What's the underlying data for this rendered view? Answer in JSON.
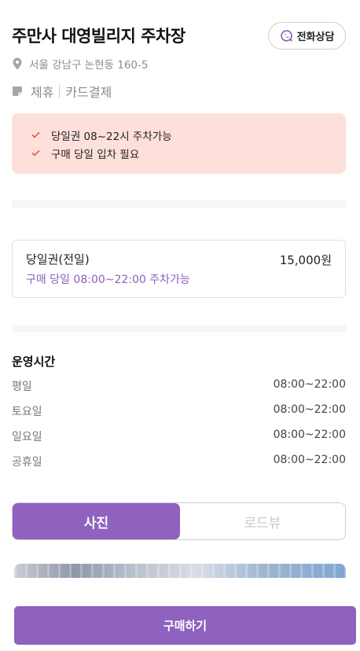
{
  "header": {
    "title": "주만사 대영빌리지 주차장",
    "call_button": {
      "label": "전화상담",
      "icon": "phone-chat-icon"
    }
  },
  "address": {
    "icon": "location-pin-icon",
    "text": "서울 강남구 논현동 160-5"
  },
  "tags": {
    "icon": "tag-icon",
    "items": [
      "제휴",
      "카드결제"
    ]
  },
  "notice": {
    "icon": "check-icon",
    "items": [
      "당일권 08~22시 주차가능",
      "구매 당일 입차 필요"
    ]
  },
  "ticket": {
    "name": "당일권(전일)",
    "price": "15,000원",
    "description": "구매 당일 08:00~22:00 주차가능"
  },
  "hours": {
    "title": "운영시간",
    "rows": [
      {
        "day": "평일",
        "time": "08:00~22:00"
      },
      {
        "day": "토요일",
        "time": "08:00~22:00"
      },
      {
        "day": "일요일",
        "time": "08:00~22:00"
      },
      {
        "day": "공휴일",
        "time": "08:00~22:00"
      }
    ]
  },
  "view_toggle": {
    "photo_label": "사진",
    "road_label": "로드뷰",
    "selected": "사진"
  },
  "purchase": {
    "label": "구매하기"
  },
  "colors": {
    "accent": "#8e62be",
    "notice_bg": "#fde0dc",
    "check": "#e05a44",
    "muted_text": "#8c8c8c"
  }
}
